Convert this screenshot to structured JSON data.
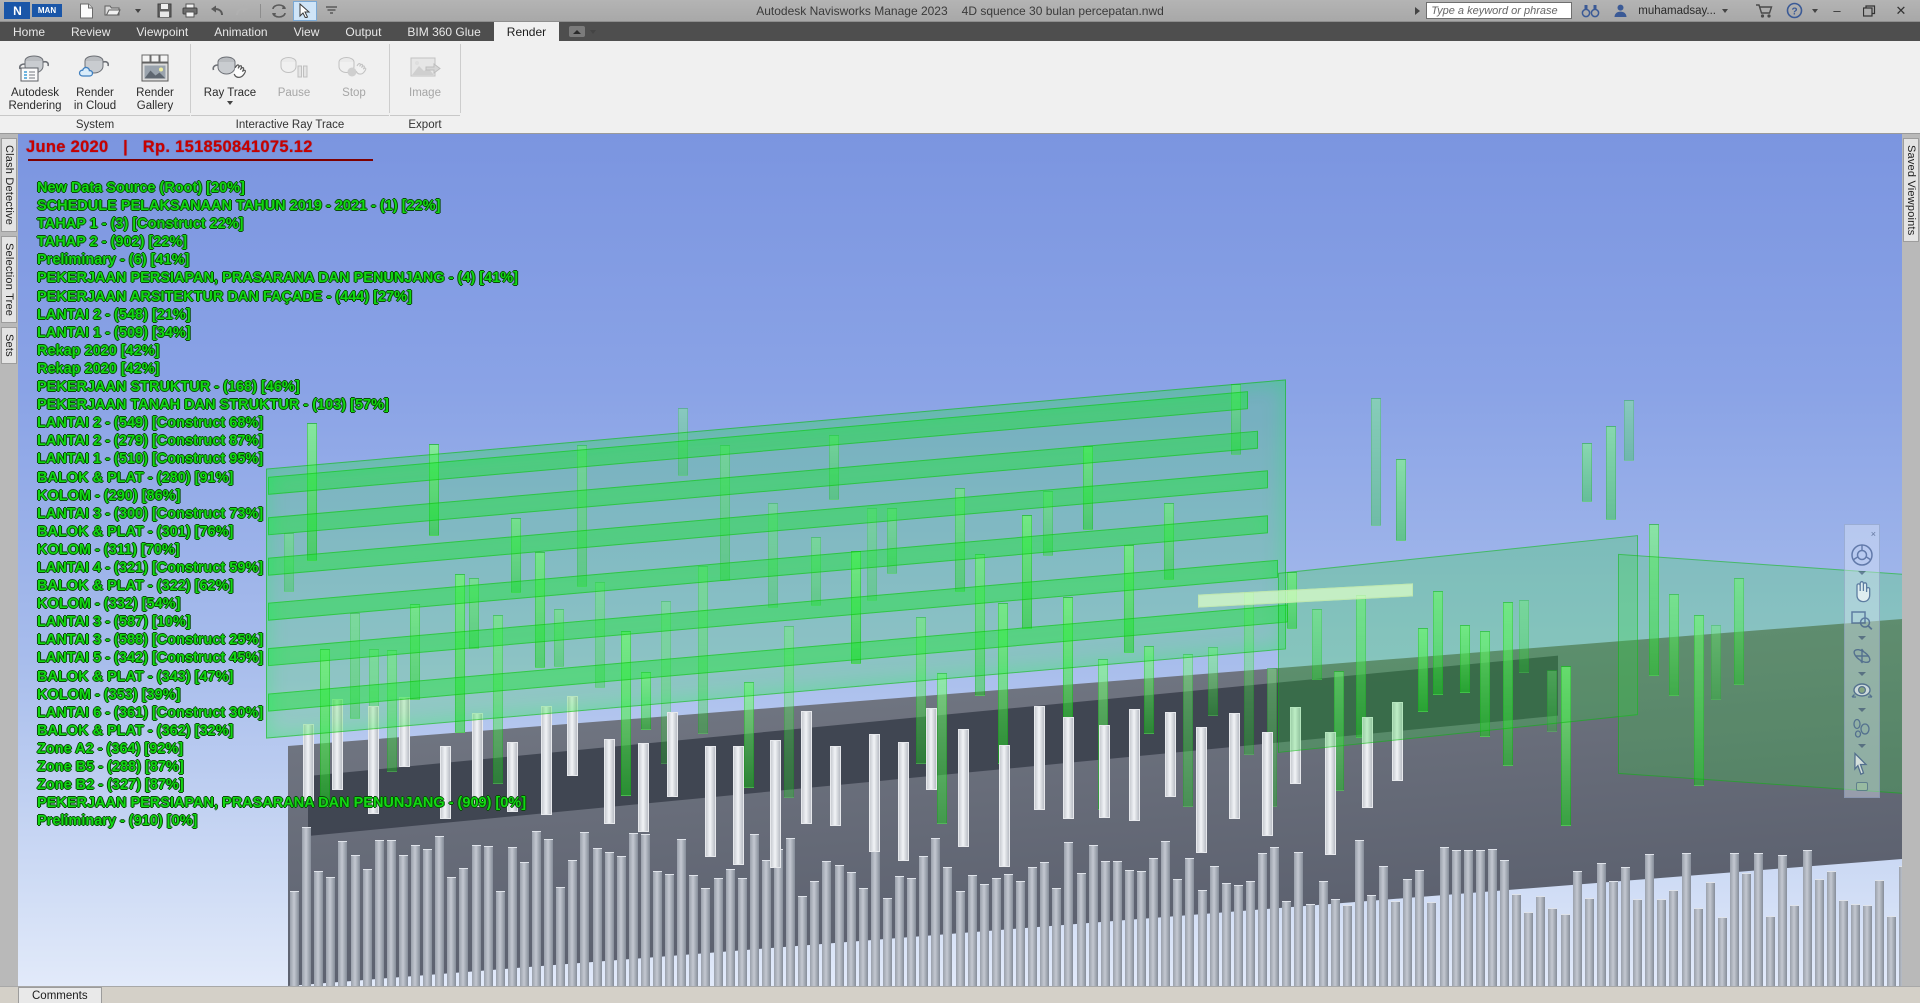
{
  "titlebar": {
    "logo": "N",
    "logo_badge": "MAN",
    "app_title": "Autodesk Navisworks Manage 2023",
    "file_name": "4D squence 30 bulan percepatan.nwd",
    "search_placeholder": "Type a keyword or phrase",
    "user_name": "muhamadsay...",
    "quick_access": [
      {
        "name": "new-document-icon",
        "label": "New"
      },
      {
        "name": "open-folder-icon",
        "label": "Open"
      },
      {
        "name": "save-icon",
        "label": "Save"
      },
      {
        "name": "print-icon",
        "label": "Print"
      },
      {
        "name": "undo-icon",
        "label": "Undo"
      },
      {
        "name": "redo-icon",
        "label": "Redo"
      },
      {
        "name": "refresh-icon",
        "label": "Refresh"
      },
      {
        "name": "select-cursor-icon",
        "label": "Select"
      }
    ],
    "window_controls": {
      "minimize": "–",
      "restore": "❐",
      "close": "✕"
    },
    "help_label": "?",
    "cart_label": "cart"
  },
  "ribbon": {
    "tabs": [
      {
        "label": "Home",
        "active": false
      },
      {
        "label": "Review",
        "active": false
      },
      {
        "label": "Viewpoint",
        "active": false
      },
      {
        "label": "Animation",
        "active": false
      },
      {
        "label": "View",
        "active": false
      },
      {
        "label": "Output",
        "active": false
      },
      {
        "label": "BIM 360 Glue",
        "active": false
      },
      {
        "label": "Render",
        "active": true
      }
    ],
    "panels": [
      {
        "label": "System",
        "buttons": [
          {
            "label_line1": "Autodesk",
            "label_line2": "Rendering",
            "icon": "teapot-settings-icon",
            "disabled": false
          },
          {
            "label_line1": "Render",
            "label_line2": "in Cloud",
            "icon": "teapot-cloud-icon",
            "disabled": false
          },
          {
            "label_line1": "Render",
            "label_line2": "Gallery",
            "icon": "render-gallery-icon",
            "disabled": false
          }
        ]
      },
      {
        "label": "Interactive Ray Trace",
        "buttons": [
          {
            "label_line1": "Ray Trace",
            "label_line2": "",
            "icon": "teapot-hand-icon",
            "disabled": false,
            "dropdown": true
          },
          {
            "label_line1": "Pause",
            "label_line2": "",
            "icon": "teapot-pause-icon",
            "disabled": true
          },
          {
            "label_line1": "Stop",
            "label_line2": "",
            "icon": "teapot-stop-icon",
            "disabled": true
          }
        ]
      },
      {
        "label": "Export",
        "buttons": [
          {
            "label_line1": "Image",
            "label_line2": "",
            "icon": "export-image-icon",
            "disabled": true
          }
        ]
      }
    ]
  },
  "left_rail": {
    "tabs": [
      {
        "label": "Clash Detective",
        "name": "clash-detective"
      },
      {
        "label": "Selection Tree",
        "name": "selection-tree"
      },
      {
        "label": "Sets",
        "name": "sets"
      }
    ]
  },
  "right_rail": {
    "tabs": [
      {
        "label": "Saved Viewpoints",
        "name": "saved-viewpoints"
      }
    ]
  },
  "viewport": {
    "overlay": {
      "header_date": "June 2020",
      "header_sep": "|",
      "header_cost": "Rp. 151850841075.12",
      "items": [
        "New Data Source (Root) [20%]",
        "SCHEDULE PELAKSANAAN TAHUN 2019 - 2021 - (1) [22%]",
        "TAHAP 1 - (3) [Construct 22%]",
        "TAHAP 2 - (902) [22%]",
        "Preliminary - (6) [41%]",
        "PEKERJAAN PERSIAPAN, PRASARANA DAN PENUNJANG - (4) [41%]",
        "PEKERJAAN ARSITEKTUR DAN FAÇADE - (444) [27%]",
        "LANTAI 2 - (548) [21%]",
        "LANTAI 1 - (509) [34%]",
        "Rekap 2020 [42%]",
        "Rekap 2020 [42%]",
        "PEKERJAAN STRUKTUR - (168) [46%]",
        "PEKERJAAN TANAH DAN STRUKTUR - (103) [57%]",
        "LANTAI 2 - (549) [Construct 68%]",
        "LANTAI 2 - (279) [Construct 87%]",
        "LANTAI 1 - (510) [Construct 95%]",
        "BALOK & PLAT - (280) [91%]",
        "KOLOM - (290) [86%]",
        "LANTAI 3 - (300) [Construct 73%]",
        "BALOK & PLAT - (301) [76%]",
        "KOLOM - (311) [70%]",
        "LANTAI 4 - (321) [Construct 59%]",
        "BALOK & PLAT - (322) [62%]",
        "KOLOM - (332) [54%]",
        "LANTAI 3 - (587) [10%]",
        "LANTAI 3 - (588) [Construct 25%]",
        "LANTAI 5 - (342) [Construct 45%]",
        "BALOK & PLAT - (343) [47%]",
        "KOLOM - (353) [39%]",
        "LANTAI 6 - (361) [Construct 30%]",
        "BALOK & PLAT - (362) [32%]",
        "Zone A2 - (364) [92%]",
        "Zone B5 - (288) [87%]",
        "Zone B2 - (327) [87%]",
        "PEKERJAAN PERSIAPAN, PRASARANA DAN PENUNJANG - (909) [0%]",
        "Preliminary - (910) [0%]"
      ],
      "header_color": "#c80000",
      "item_color": "#12d912"
    },
    "navbar": {
      "close_label": "×",
      "tools": [
        {
          "name": "steering-wheel-icon",
          "has_caret": true
        },
        {
          "name": "pan-hand-icon",
          "has_caret": false
        },
        {
          "name": "zoom-window-icon",
          "has_caret": true
        },
        {
          "name": "orbit-icon",
          "has_caret": true
        },
        {
          "name": "look-around-icon",
          "has_caret": true
        },
        {
          "name": "walk-icon",
          "has_caret": true
        },
        {
          "name": "select-arrow-icon",
          "has_caret": false
        }
      ]
    }
  },
  "bottombar": {
    "comments_tab": "Comments"
  }
}
